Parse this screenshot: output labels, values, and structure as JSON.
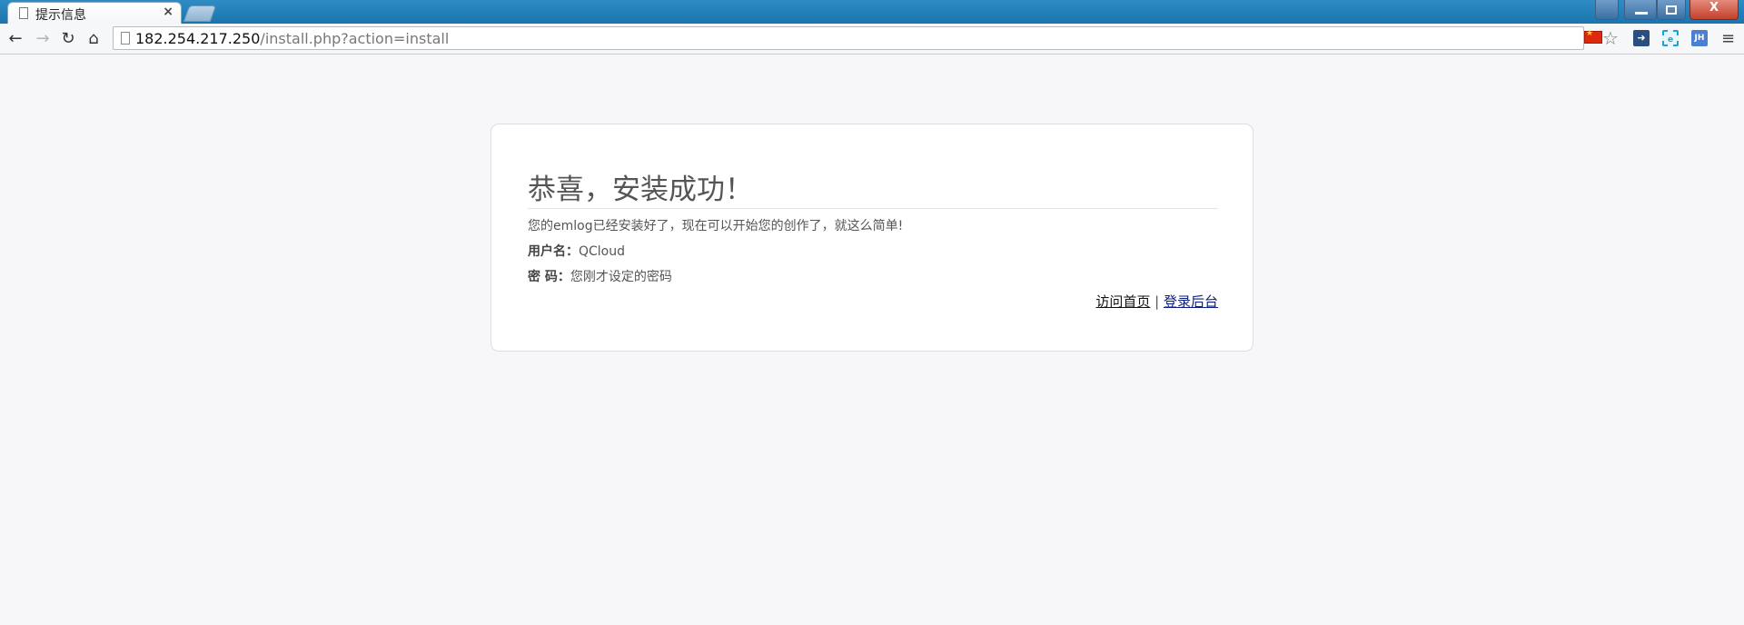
{
  "browser": {
    "tab_title": "提示信息",
    "tab_close": "×",
    "url_host": "182.254.217.250",
    "url_rest": "/install.php?action=install",
    "back": "←",
    "forward": "→",
    "reload": "↻",
    "home": "⌂",
    "bookmark": "☆",
    "menu": "≡",
    "ext3_label": "JH",
    "ext2_label": "e",
    "close_glyph": "X",
    "accent": "#1b74ad"
  },
  "card": {
    "title": "恭喜，安装成功！",
    "message": "您的emlog已经安装好了，现在可以开始您的创作了，就这么简单!",
    "username_label": "用户名：",
    "username_value": "QCloud",
    "password_label": "密 码：",
    "password_value": "您刚才设定的密码",
    "link_home": "访问首页",
    "separator": " | ",
    "link_admin": "登录后台"
  }
}
